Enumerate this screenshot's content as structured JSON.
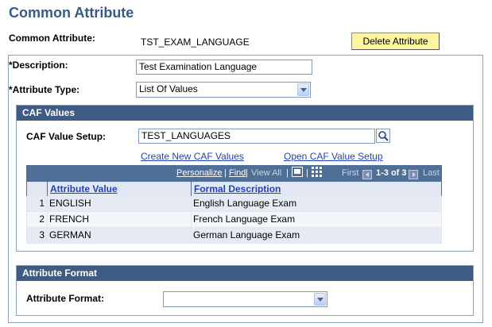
{
  "page": {
    "title": "Common Attribute"
  },
  "header": {
    "common_attribute_label": "Common Attribute:",
    "common_attribute_value": "TST_EXAM_LANGUAGE",
    "delete_button": "Delete Attribute"
  },
  "form": {
    "description_label": "*Description:",
    "description_value": "Test Examination Language",
    "attribute_type_label": "*Attribute Type:",
    "attribute_type_value": "List Of Values"
  },
  "caf_values": {
    "title": "CAF Values",
    "setup_label": "CAF Value Setup:",
    "setup_value": "TEST_LANGUAGES",
    "create_link": "Create New CAF Values",
    "open_link": "Open CAF Value Setup",
    "grid": {
      "personalize": "Personalize",
      "find": "Find",
      "view_all": "View All",
      "first": "First",
      "range": "1-3 of 3",
      "last": "Last",
      "columns": [
        "Attribute Value",
        "Formal Description"
      ],
      "rows": [
        {
          "num": "1",
          "value": "ENGLISH",
          "description": "English Language Exam"
        },
        {
          "num": "2",
          "value": "FRENCH",
          "description": "French Language Exam"
        },
        {
          "num": "3",
          "value": "GERMAN",
          "description": "German Language Exam"
        }
      ]
    }
  },
  "attribute_format": {
    "title": "Attribute Format",
    "label": "Attribute Format:",
    "value": ""
  },
  "icons": {
    "lookup": "magnifier-icon",
    "dropdown": "chevron-down-icon",
    "download": "download-icon",
    "grid_view": "grid-icon",
    "prev": "prev-arrow-icon",
    "next": "next-arrow-icon"
  },
  "colors": {
    "title": "#395A82",
    "group_header": "#3E5C83",
    "button": "#FCF59F",
    "link": "#2341B7",
    "grid_border": "#506F97"
  }
}
